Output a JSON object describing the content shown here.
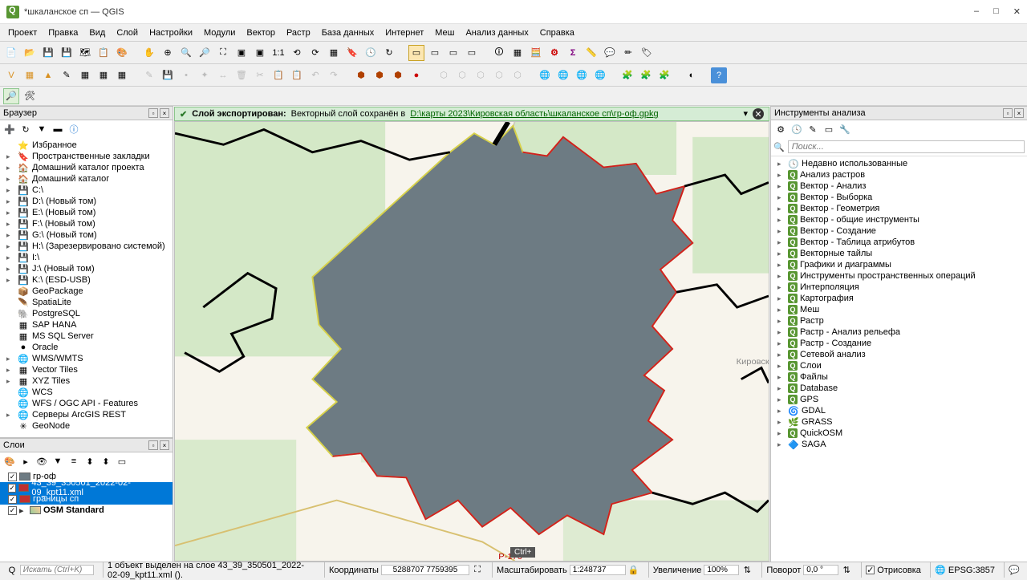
{
  "window": {
    "title": "*шкаланское сп — QGIS"
  },
  "menu": [
    "Проект",
    "Правка",
    "Вид",
    "Слой",
    "Настройки",
    "Модули",
    "Вектор",
    "Растр",
    "База данных",
    "Интернет",
    "Меш",
    "Анализ данных",
    "Справка"
  ],
  "message": {
    "title": "Слой экспортирован:",
    "body": "Векторный слой сохранён в ",
    "link": "D:\\карты 2023\\Кировская область\\шкаланское сп\\гр-оф.gpkg"
  },
  "panels": {
    "browser_title": "Браузер",
    "layers_title": "Слои",
    "processing_title": "Инструменты анализа"
  },
  "browser": [
    {
      "label": "Избранное",
      "icon": "⭐",
      "exp": ""
    },
    {
      "label": "Пространственные закладки",
      "icon": "🔖",
      "exp": "▸"
    },
    {
      "label": "Домашний каталог проекта",
      "icon": "🏠",
      "exp": "▸"
    },
    {
      "label": "Домашний каталог",
      "icon": "🏠",
      "exp": "▸"
    },
    {
      "label": "C:\\",
      "icon": "💾",
      "exp": "▸"
    },
    {
      "label": "D:\\ (Новый том)",
      "icon": "💾",
      "exp": "▸"
    },
    {
      "label": "E:\\ (Новый том)",
      "icon": "💾",
      "exp": "▸"
    },
    {
      "label": "F:\\ (Новый том)",
      "icon": "💾",
      "exp": "▸"
    },
    {
      "label": "G:\\ (Новый том)",
      "icon": "💾",
      "exp": "▸"
    },
    {
      "label": "H:\\ (Зарезервировано системой)",
      "icon": "💾",
      "exp": "▸"
    },
    {
      "label": "I:\\",
      "icon": "💾",
      "exp": "▸"
    },
    {
      "label": "J:\\ (Новый том)",
      "icon": "💾",
      "exp": "▸"
    },
    {
      "label": "K:\\ (ESD-USB)",
      "icon": "💾",
      "exp": "▸"
    },
    {
      "label": "GeoPackage",
      "icon": "📦",
      "exp": ""
    },
    {
      "label": "SpatiaLite",
      "icon": "🪶",
      "exp": ""
    },
    {
      "label": "PostgreSQL",
      "icon": "🐘",
      "exp": ""
    },
    {
      "label": "SAP HANA",
      "icon": "▦",
      "exp": ""
    },
    {
      "label": "MS SQL Server",
      "icon": "▦",
      "exp": ""
    },
    {
      "label": "Oracle",
      "icon": "●",
      "exp": ""
    },
    {
      "label": "WMS/WMTS",
      "icon": "🌐",
      "exp": "▸"
    },
    {
      "label": "Vector Tiles",
      "icon": "▦",
      "exp": "▸"
    },
    {
      "label": "XYZ Tiles",
      "icon": "▦",
      "exp": "▸"
    },
    {
      "label": "WCS",
      "icon": "🌐",
      "exp": ""
    },
    {
      "label": "WFS / OGC API - Features",
      "icon": "🌐",
      "exp": ""
    },
    {
      "label": "Серверы ArcGIS REST",
      "icon": "🌐",
      "exp": "▸"
    },
    {
      "label": "GeoNode",
      "icon": "✳",
      "exp": ""
    }
  ],
  "layers": [
    {
      "name": "гр-оф",
      "checked": true,
      "sel": false,
      "color": "#6d7b83"
    },
    {
      "name": "43_39_350501_2022-02-09_kpt11.xml",
      "checked": true,
      "sel": true,
      "color": "#c03030"
    },
    {
      "name": "границы сп",
      "checked": true,
      "sel": true,
      "color": "#c03030"
    },
    {
      "name": "OSM Standard",
      "checked": true,
      "sel": false,
      "osm": true
    }
  ],
  "proc_search_placeholder": "Поиск...",
  "processing": [
    {
      "label": "Недавно использованные",
      "icon": "🕓"
    },
    {
      "label": "Анализ растров",
      "icon": "Q"
    },
    {
      "label": "Вектор - Анализ",
      "icon": "Q"
    },
    {
      "label": "Вектор - Выборка",
      "icon": "Q"
    },
    {
      "label": "Вектор - Геометрия",
      "icon": "Q"
    },
    {
      "label": "Вектор - общие инструменты",
      "icon": "Q"
    },
    {
      "label": "Вектор - Создание",
      "icon": "Q"
    },
    {
      "label": "Вектор - Таблица атрибутов",
      "icon": "Q"
    },
    {
      "label": "Векторные тайлы",
      "icon": "Q"
    },
    {
      "label": "Графики и диаграммы",
      "icon": "Q"
    },
    {
      "label": "Инструменты пространственных операций",
      "icon": "Q"
    },
    {
      "label": "Интерполяция",
      "icon": "Q"
    },
    {
      "label": "Картография",
      "icon": "Q"
    },
    {
      "label": "Меш",
      "icon": "Q"
    },
    {
      "label": "Растр",
      "icon": "Q"
    },
    {
      "label": "Растр - Анализ рельефа",
      "icon": "Q"
    },
    {
      "label": "Растр - Создание",
      "icon": "Q"
    },
    {
      "label": "Сетевой анализ",
      "icon": "Q"
    },
    {
      "label": "Слои",
      "icon": "Q"
    },
    {
      "label": "Файлы",
      "icon": "Q"
    },
    {
      "label": "Database",
      "icon": "Q"
    },
    {
      "label": "GPS",
      "icon": "Q"
    },
    {
      "label": "GDAL",
      "icon": "🌀"
    },
    {
      "label": "GRASS",
      "icon": "🌿"
    },
    {
      "label": "QuickOSM",
      "icon": "Q"
    },
    {
      "label": "SAGA",
      "icon": "🔷"
    }
  ],
  "status": {
    "search_placeholder": "Искать (Ctrl+K)",
    "info": "1 объект выделен на слое  43_39_350501_2022-02-09_kpt11.xml ().",
    "coord_label": "Координаты",
    "coord_value": "5288707 7759395",
    "scale_label": "Масштабировать",
    "scale_value": "1:248737",
    "zoom_label": "Увеличение",
    "zoom_value": "100%",
    "rot_label": "Поворот",
    "rot_value": "0,0 °",
    "render_label": "Отрисовка",
    "crs": "EPSG:3857",
    "ctrl_badge": "Ctrl+"
  }
}
